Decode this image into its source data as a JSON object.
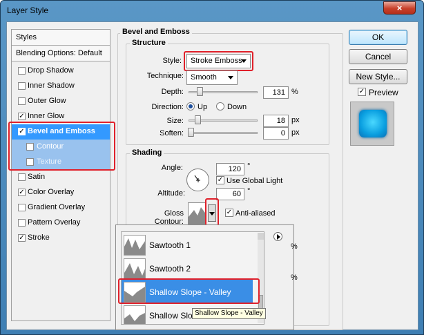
{
  "window": {
    "title": "Layer Style",
    "close_glyph": "×"
  },
  "styles_panel": {
    "header": "Styles",
    "blending": "Blending Options: Default",
    "items": [
      {
        "label": "Drop Shadow",
        "checked": false
      },
      {
        "label": "Inner Shadow",
        "checked": false
      },
      {
        "label": "Outer Glow",
        "checked": false
      },
      {
        "label": "Inner Glow",
        "checked": true
      },
      {
        "label": "Bevel and Emboss",
        "checked": true
      },
      {
        "label": "Contour",
        "checked": true
      },
      {
        "label": "Texture",
        "checked": false
      },
      {
        "label": "Satin",
        "checked": false
      },
      {
        "label": "Color Overlay",
        "checked": true
      },
      {
        "label": "Gradient Overlay",
        "checked": false
      },
      {
        "label": "Pattern Overlay",
        "checked": false
      },
      {
        "label": "Stroke",
        "checked": true
      }
    ]
  },
  "bevel": {
    "title": "Bevel and Emboss",
    "structure": {
      "title": "Structure",
      "style_label": "Style:",
      "style_value": "Stroke Emboss",
      "technique_label": "Technique:",
      "technique_value": "Smooth",
      "depth_label": "Depth:",
      "depth_value": "131",
      "depth_unit": "%",
      "direction_label": "Direction:",
      "up_label": "Up",
      "down_label": "Down",
      "size_label": "Size:",
      "size_value": "18",
      "size_unit": "px",
      "soften_label": "Soften:",
      "soften_value": "0",
      "soften_unit": "px"
    },
    "shading": {
      "title": "Shading",
      "angle_label": "Angle:",
      "angle_value": "120",
      "angle_unit": "°",
      "global_light_label": "Use Global Light",
      "altitude_label": "Altitude:",
      "altitude_value": "60",
      "altitude_unit": "°",
      "gloss_label": "Gloss Contour:",
      "antialiased_label": "Anti-aliased"
    }
  },
  "buttons": {
    "ok": "OK",
    "cancel": "Cancel",
    "new_style": "New Style...",
    "preview_label": "Preview"
  },
  "popup": {
    "items": [
      "Sawtooth 1",
      "Sawtooth 2",
      "Shallow Slope - Valley",
      "Shallow Slope - Valley"
    ],
    "selected_index": 2,
    "truncated_last": "Shallow Slo",
    "tooltip": "Shallow Slope - Valley",
    "hidden_pct": "%"
  },
  "colors": {
    "accent": "#3399ff",
    "highlight": "#e0202a",
    "preview": "#00a8e8"
  }
}
